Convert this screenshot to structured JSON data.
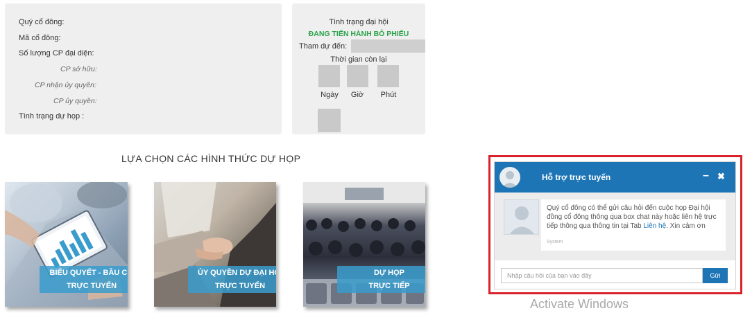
{
  "shareholder_info": {
    "name_label": "Quý cổ đông:",
    "code_label": "Mã cổ đông:",
    "shares_label": "Số lượng CP đại diện:",
    "owned_label": "CP sở hữu:",
    "proxy_received_label": "CP nhận ủy quyền:",
    "proxy_given_label": "CP ủy quyền:",
    "attendance_status_label": "Tình trạng dự họp :"
  },
  "meeting_status": {
    "title": "Tình trạng đại hội",
    "value": "ĐANG TIẾN HÀNH BỎ PHIẾU",
    "value_color": "#2aa34a",
    "attend_label": "Tham dự đến:",
    "remaining_label": "Thời gian còn lại",
    "countdown": [
      {
        "label": "Ngày"
      },
      {
        "label": "Giờ"
      },
      {
        "label": "Phút"
      }
    ]
  },
  "attendance_options": {
    "title": "LỰA CHỌN CÁC HÌNH THỨC DỰ HỌP",
    "cards": [
      {
        "line1": "BIỂU QUYẾT - BẦU CỬ",
        "line2": "TRỰC TUYẾN"
      },
      {
        "line1": "ỦY QUYỀN DỰ ĐẠI HỘI",
        "line2": "TRỰC TUYẾN"
      },
      {
        "line1": "DỰ HỌP",
        "line2": "TRỰC TIẾP"
      }
    ],
    "button_color": "#3a9ccc"
  },
  "chat": {
    "title": "Hỗ trợ trực tuyến",
    "minimize_icon": "minus-icon",
    "close_icon": "close-icon",
    "message_text": "Quý cổ đông có thể gửi câu hỏi đến cuộc họp Đại hội đồng cổ đông thông qua box chat này hoặc liên hệ trực tiếp thông qua thông tin tại Tab",
    "message_link": "Liên hệ",
    "message_suffix": ". Xin cảm ơn",
    "message_sender": "System",
    "input_placeholder": "Nhập câu hỏi của bạn vào đây",
    "send_label": "Gửi",
    "header_color": "#1d75b6",
    "highlight_color": "#d9222a"
  },
  "watermark": "Activate Windows"
}
